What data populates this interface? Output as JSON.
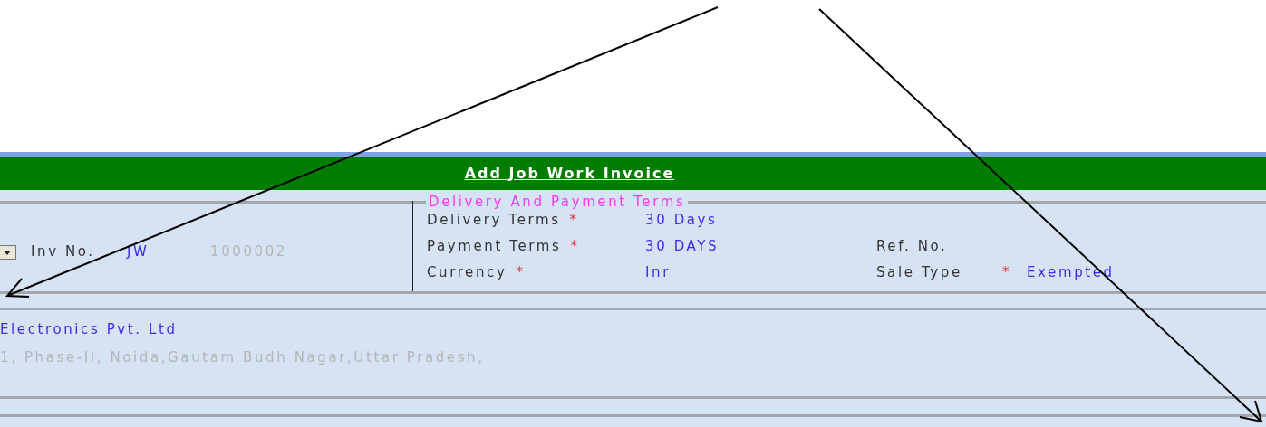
{
  "header": {
    "title": "Add Job Work Invoice"
  },
  "invoice": {
    "number_label": "Inv No.",
    "prefix": "JW",
    "number": "1000002"
  },
  "terms": {
    "legend": "Delivery And Payment Terms",
    "fields": [
      {
        "label": "Delivery Terms",
        "required_marker": "*",
        "value": "30 Days"
      },
      {
        "label": "Payment Terms",
        "required_marker": "*",
        "value": "30 DAYS"
      },
      {
        "label": "Currency",
        "required_marker": "*",
        "value": "Inr"
      }
    ],
    "other_fields": [
      {
        "label": "Ref. No."
      },
      {
        "label": "Sale Type",
        "required_marker": "*",
        "value": "Exempted"
      }
    ]
  },
  "customer": {
    "name": "Electronics Pvt. Ltd",
    "address": "1, Phase-II, Noida,Gautam Budh Nagar,Uttar Pradesh,"
  }
}
